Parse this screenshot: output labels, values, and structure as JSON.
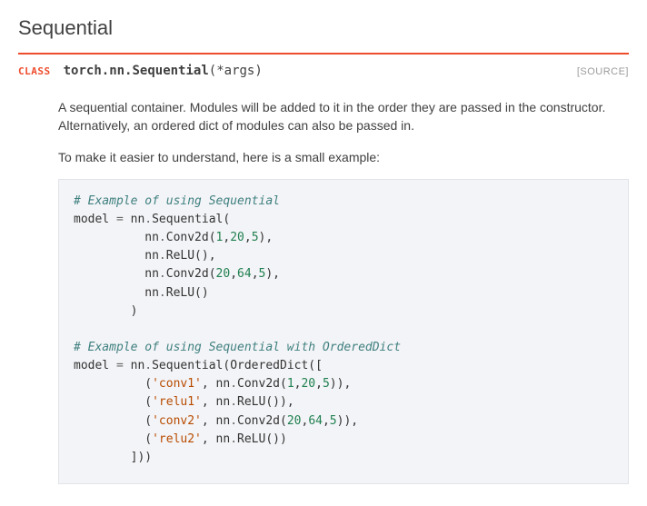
{
  "section_title": "Sequential",
  "class_def": {
    "keyword": "CLASS",
    "qualname": "torch.nn.Sequential",
    "args": "(*args)",
    "source_label": "[SOURCE]"
  },
  "paragraphs": {
    "desc": "A sequential container. Modules will be added to it in the order they are passed in the constructor. Alternatively, an ordered dict of modules can also be passed in.",
    "example_intro": "To make it easier to understand, here is a small example:"
  },
  "code": {
    "c1": "# Example of using Sequential",
    "l2a": "model ",
    "l2b": "=",
    "l2c": " nn",
    "l2d": ".",
    "l2e": "Sequential(",
    "l3a": "          nn",
    "l3b": ".",
    "l3c": "Conv2d(",
    "l3d": "1",
    "l3e": ",",
    "l3f": "20",
    "l3g": ",",
    "l3h": "5",
    "l3i": "),",
    "l4a": "          nn",
    "l4b": ".",
    "l4c": "ReLU(),",
    "l5a": "          nn",
    "l5b": ".",
    "l5c": "Conv2d(",
    "l5d": "20",
    "l5e": ",",
    "l5f": "64",
    "l5g": ",",
    "l5h": "5",
    "l5i": "),",
    "l6a": "          nn",
    "l6b": ".",
    "l6c": "ReLU()",
    "l7": "        )",
    "c2": "# Example of using Sequential with OrderedDict",
    "l9a": "model ",
    "l9b": "=",
    "l9c": " nn",
    "l9d": ".",
    "l9e": "Sequential(OrderedDict([",
    "l10a": "          (",
    "l10b": "'conv1'",
    "l10c": ", nn",
    "l10d": ".",
    "l10e": "Conv2d(",
    "l10f": "1",
    "l10g": ",",
    "l10h": "20",
    "l10i": ",",
    "l10j": "5",
    "l10k": ")),",
    "l11a": "          (",
    "l11b": "'relu1'",
    "l11c": ", nn",
    "l11d": ".",
    "l11e": "ReLU()),",
    "l12a": "          (",
    "l12b": "'conv2'",
    "l12c": ", nn",
    "l12d": ".",
    "l12e": "Conv2d(",
    "l12f": "20",
    "l12g": ",",
    "l12h": "64",
    "l12i": ",",
    "l12j": "5",
    "l12k": ")),",
    "l13a": "          (",
    "l13b": "'relu2'",
    "l13c": ", nn",
    "l13d": ".",
    "l13e": "ReLU())",
    "l14": "        ]))"
  }
}
